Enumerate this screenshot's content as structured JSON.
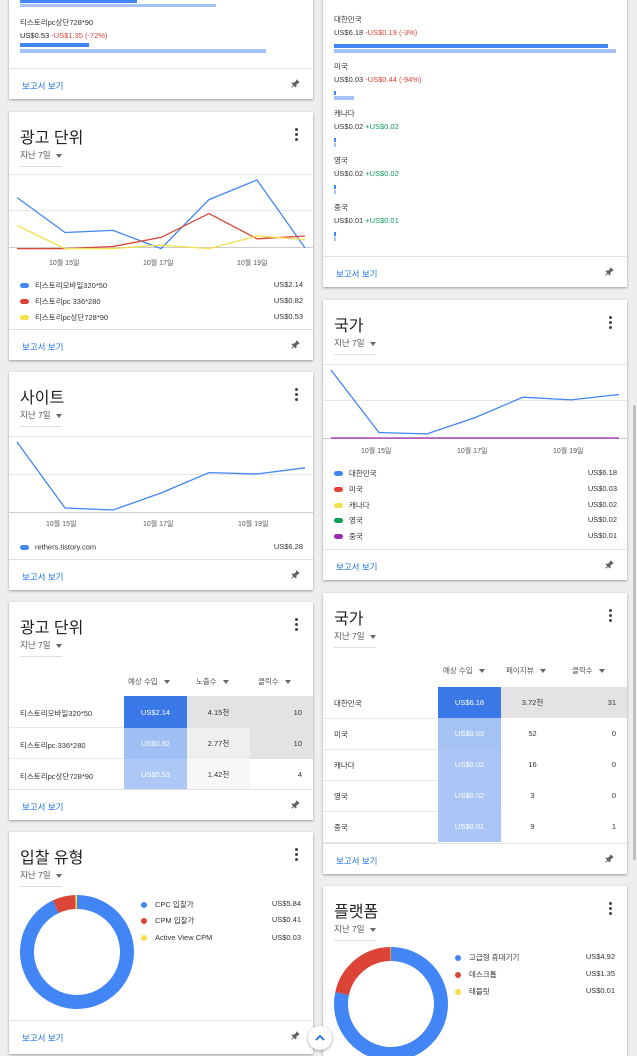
{
  "colors": {
    "blue": "#4285f4",
    "red": "#db4437",
    "yellow": "#f4e04d",
    "green": "#0f9d58",
    "purple": "#9c27b0",
    "light_blue": "#a4c2f4",
    "link": "#1a73e8"
  },
  "common": {
    "period": "지난 7일",
    "view_report": "보고서 보기"
  },
  "top_left": {
    "item_label": "티스토리pc상단728*90",
    "item_value": "US$0.53",
    "item_delta": "-US$1.35 (-72%)",
    "current_fraction": 0.27,
    "previous_fraction": 0.97
  },
  "top_right": {
    "items": [
      {
        "label": "대한민국",
        "value": "US$6.18",
        "delta": "-US$0.19 (-3%)",
        "delta_color": "red",
        "current_fraction": 0.97,
        "previous_fraction": 1.0
      },
      {
        "label": "미국",
        "value": "US$0.03",
        "delta": "-US$0.44 (-94%)",
        "delta_color": "red",
        "current_fraction": 0.004,
        "previous_fraction": 0.07
      },
      {
        "label": "캐나다",
        "value": "US$0.02",
        "delta": "+US$0.02",
        "delta_color": "green",
        "current_fraction": 0.003,
        "previous_fraction": 0
      },
      {
        "label": "영국",
        "value": "US$0.02",
        "delta": "+US$0.02",
        "delta_color": "green",
        "current_fraction": 0.003,
        "previous_fraction": 0
      },
      {
        "label": "중국",
        "value": "US$0.01",
        "delta": "+US$0.01",
        "delta_color": "green",
        "current_fraction": 0.002,
        "previous_fraction": 0
      }
    ]
  },
  "adunit_chart": {
    "title": "광고 단위",
    "x_ticks": [
      "10월 15일",
      "10월 17일",
      "10월 19일"
    ],
    "legend": [
      {
        "name": "티스토리모바일320*50",
        "value": "US$2.14",
        "color": "blue"
      },
      {
        "name": "티스토리pc 336*280",
        "value": "US$0.82",
        "color": "red"
      },
      {
        "name": "티스토리pc상단728*90",
        "value": "US$0.53",
        "color": "yellow"
      }
    ]
  },
  "site_chart": {
    "title": "사이트",
    "x_ticks": [
      "10월 15일",
      "10월 17일",
      "10월 19일"
    ],
    "legend": [
      {
        "name": "rethers.tistory.com",
        "value": "US$6.28",
        "color": "blue"
      }
    ]
  },
  "country_chart": {
    "title": "국가",
    "x_ticks": [
      "10월 15일",
      "10월 17일",
      "10월 19일"
    ],
    "legend": [
      {
        "name": "대한민국",
        "value": "US$6.18",
        "color": "blue"
      },
      {
        "name": "미국",
        "value": "US$0.03",
        "color": "red"
      },
      {
        "name": "캐나다",
        "value": "US$0.02",
        "color": "yellow"
      },
      {
        "name": "영국",
        "value": "US$0.02",
        "color": "green"
      },
      {
        "name": "중국",
        "value": "US$0.01",
        "color": "purple"
      }
    ]
  },
  "adunit_table": {
    "title": "광고 단위",
    "headers": [
      "예상 수입",
      "노출수",
      "클릭수"
    ],
    "rows": [
      {
        "name": "티스토리모바일320*50",
        "revenue": "US$2.14",
        "impressions": "4.15천",
        "clicks": "10"
      },
      {
        "name": "티스토리pc 336*280",
        "revenue": "US$0.82",
        "impressions": "2.77천",
        "clicks": "10"
      },
      {
        "name": "티스토리pc상단728*90",
        "revenue": "US$0.53",
        "impressions": "1.42천",
        "clicks": "4"
      }
    ]
  },
  "country_table": {
    "title": "국가",
    "headers": [
      "예상 수입",
      "페이지뷰",
      "클릭수"
    ],
    "rows": [
      {
        "name": "대한민국",
        "revenue": "US$6.18",
        "pageviews": "3.72천",
        "clicks": "31"
      },
      {
        "name": "미국",
        "revenue": "US$0.03",
        "pageviews": "52",
        "clicks": "0"
      },
      {
        "name": "캐나다",
        "revenue": "US$0.02",
        "pageviews": "16",
        "clicks": "0"
      },
      {
        "name": "영국",
        "revenue": "US$0.02",
        "pageviews": "3",
        "clicks": "0"
      },
      {
        "name": "중국",
        "revenue": "US$0.01",
        "pageviews": "9",
        "clicks": "1"
      }
    ]
  },
  "bid_type": {
    "title": "입찰 유형",
    "legend": [
      {
        "name": "CPC 입찰가",
        "value": "US$5.84",
        "color": "blue"
      },
      {
        "name": "CPM 입찰가",
        "value": "US$0.41",
        "color": "red"
      },
      {
        "name": "Active View CPM",
        "value": "US$0.03",
        "color": "yellow"
      }
    ]
  },
  "platform": {
    "title": "플랫폼",
    "legend": [
      {
        "name": "고급형 휴대기기",
        "value": "US$4.92",
        "color": "blue"
      },
      {
        "name": "데스크톱",
        "value": "US$1.35",
        "color": "red"
      },
      {
        "name": "태블릿",
        "value": "US$0.01",
        "color": "yellow"
      }
    ]
  },
  "chart_data": [
    {
      "type": "line",
      "title": "광고 단위",
      "x": [
        "10월 14일",
        "10월 15일",
        "10월 16일",
        "10월 17일",
        "10월 18일",
        "10월 19일",
        "10월 20일"
      ],
      "series": [
        {
          "name": "티스토리모바일320*50",
          "values": [
            0.75,
            0.25,
            0.28,
            0.02,
            0.72,
            1.0,
            0.03
          ]
        },
        {
          "name": "티스토리pc 336*280",
          "values": [
            0.02,
            0.02,
            0.05,
            0.18,
            0.52,
            0.16,
            0.2
          ]
        },
        {
          "name": "티스토리pc상단728*90",
          "values": [
            0.35,
            0.02,
            0.02,
            0.07,
            0.02,
            0.2,
            0.15
          ]
        }
      ]
    },
    {
      "type": "line",
      "title": "사이트",
      "x": [
        "10월 14일",
        "10월 15일",
        "10월 16일",
        "10월 17일",
        "10월 18일",
        "10월 19일",
        "10월 20일"
      ],
      "series": [
        {
          "name": "rethers.tistory.com",
          "values": [
            1.0,
            0.03,
            0.0,
            0.25,
            0.55,
            0.53,
            0.62
          ]
        }
      ]
    },
    {
      "type": "line",
      "title": "국가",
      "x": [
        "10월 14일",
        "10월 15일",
        "10월 16일",
        "10월 17일",
        "10월 18일",
        "10월 19일",
        "10월 20일"
      ],
      "series": [
        {
          "name": "대한민국",
          "values": [
            1.0,
            0.08,
            0.06,
            0.3,
            0.6,
            0.56,
            0.64
          ]
        },
        {
          "name": "미국",
          "values": [
            0.0,
            0.0,
            0.0,
            0.0,
            0.0,
            0.0,
            0.0
          ]
        }
      ]
    },
    {
      "type": "pie",
      "title": "입찰 유형",
      "categories": [
        "CPC 입찰가",
        "CPM 입찰가",
        "Active View CPM"
      ],
      "values": [
        5.84,
        0.41,
        0.03
      ]
    },
    {
      "type": "pie",
      "title": "플랫폼",
      "categories": [
        "고급형 휴대기기",
        "데스크톱",
        "태블릿"
      ],
      "values": [
        4.92,
        1.35,
        0.01
      ]
    }
  ]
}
